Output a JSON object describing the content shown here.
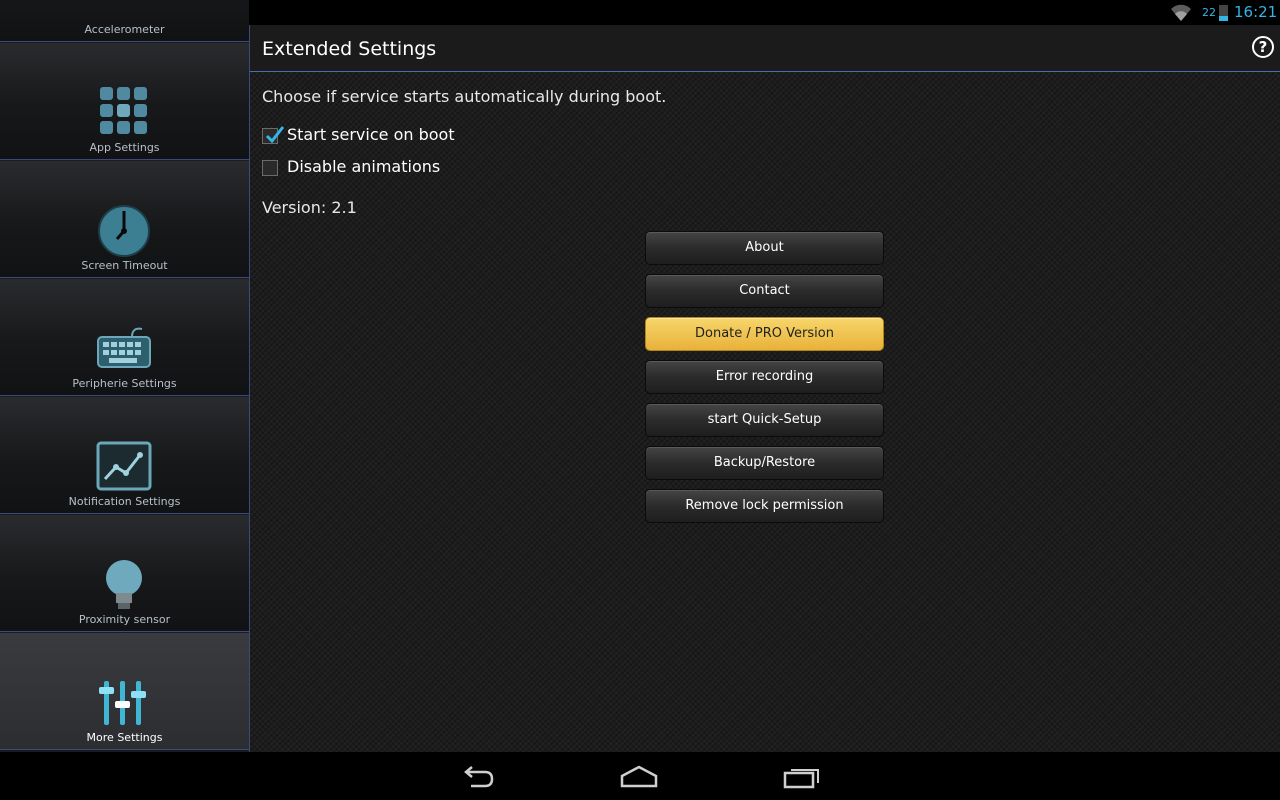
{
  "status_bar": {
    "battery_percent": "22",
    "battery_level": 0.22,
    "time": "16:21",
    "icons": [
      "image-notification-icon",
      "wifi-icon",
      "battery-icon"
    ]
  },
  "sidebar": {
    "items": [
      {
        "label": "Accelerometer",
        "icon": "accelerometer-icon",
        "active": false
      },
      {
        "label": "App Settings",
        "icon": "app-grid-icon",
        "active": false
      },
      {
        "label": "Screen Timeout",
        "icon": "clock-icon",
        "active": false
      },
      {
        "label": "Peripherie Settings",
        "icon": "keyboard-icon",
        "active": false
      },
      {
        "label": "Notification Settings",
        "icon": "chart-icon",
        "active": false
      },
      {
        "label": "Proximity sensor",
        "icon": "lightbulb-icon",
        "active": false
      },
      {
        "label": "More Settings",
        "icon": "sliders-icon",
        "active": true
      }
    ]
  },
  "main": {
    "title": "Extended Settings",
    "help_icon": "?",
    "description": "Choose if service starts automatically during boot.",
    "checkboxes": [
      {
        "label": "Start service on boot",
        "checked": true
      },
      {
        "label": "Disable animations",
        "checked": false
      }
    ],
    "version": "Version: 2.1",
    "buttons": [
      {
        "label": "About"
      },
      {
        "label": "Contact"
      },
      {
        "label": "Donate / PRO Version",
        "highlight": true
      },
      {
        "label": "Error recording"
      },
      {
        "label": "start Quick-Setup"
      },
      {
        "label": "Backup/Restore"
      },
      {
        "label": "Remove lock permission"
      }
    ]
  },
  "nav_bar": {
    "icons": [
      "back-icon",
      "home-icon",
      "recent-apps-icon"
    ]
  },
  "colors": {
    "accent": "#33b5e5",
    "donate_button": "#f0c24f",
    "divider": "#4a6fae"
  }
}
